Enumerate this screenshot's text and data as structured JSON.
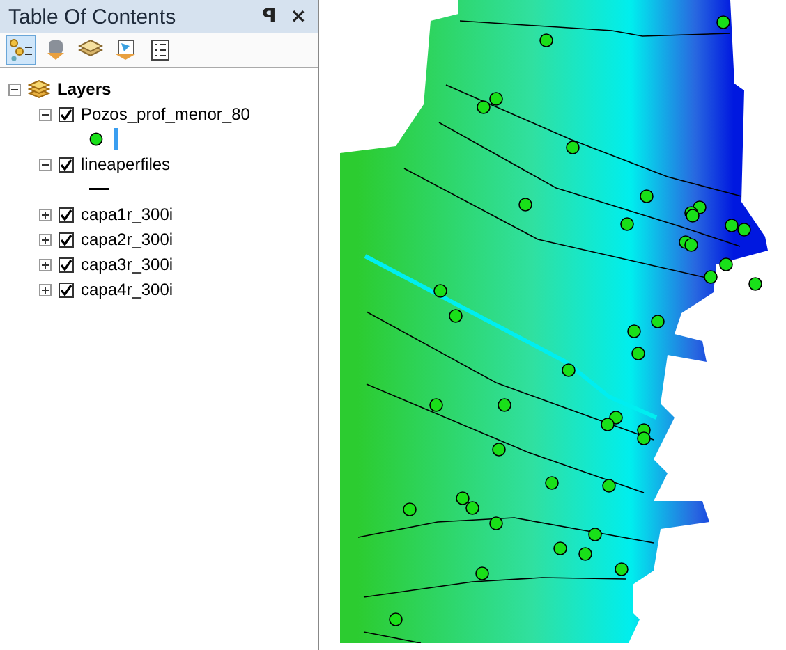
{
  "panel": {
    "title": "Table Of Contents",
    "pin": "ꟼ",
    "close": "×"
  },
  "toolbar": [
    {
      "kind": "drawing-order",
      "selected": true
    },
    {
      "kind": "source",
      "selected": false
    },
    {
      "kind": "visibility",
      "selected": false
    },
    {
      "kind": "selection",
      "selected": false
    },
    {
      "kind": "options",
      "selected": false
    }
  ],
  "root": {
    "label": "Layers",
    "expanded": true
  },
  "layers": [
    {
      "name": "Pozos_prof_menor_80",
      "checked": true,
      "expanded": true,
      "kind": "point"
    },
    {
      "name": "lineaperfiles",
      "checked": true,
      "expanded": true,
      "kind": "line"
    },
    {
      "name": "capa1r_300i",
      "checked": true,
      "expanded": false
    },
    {
      "name": "capa2r_300i",
      "checked": true,
      "expanded": false
    },
    {
      "name": "capa3r_300i",
      "checked": true,
      "expanded": false
    },
    {
      "name": "capa4r_300i",
      "checked": true,
      "expanded": false
    }
  ]
}
